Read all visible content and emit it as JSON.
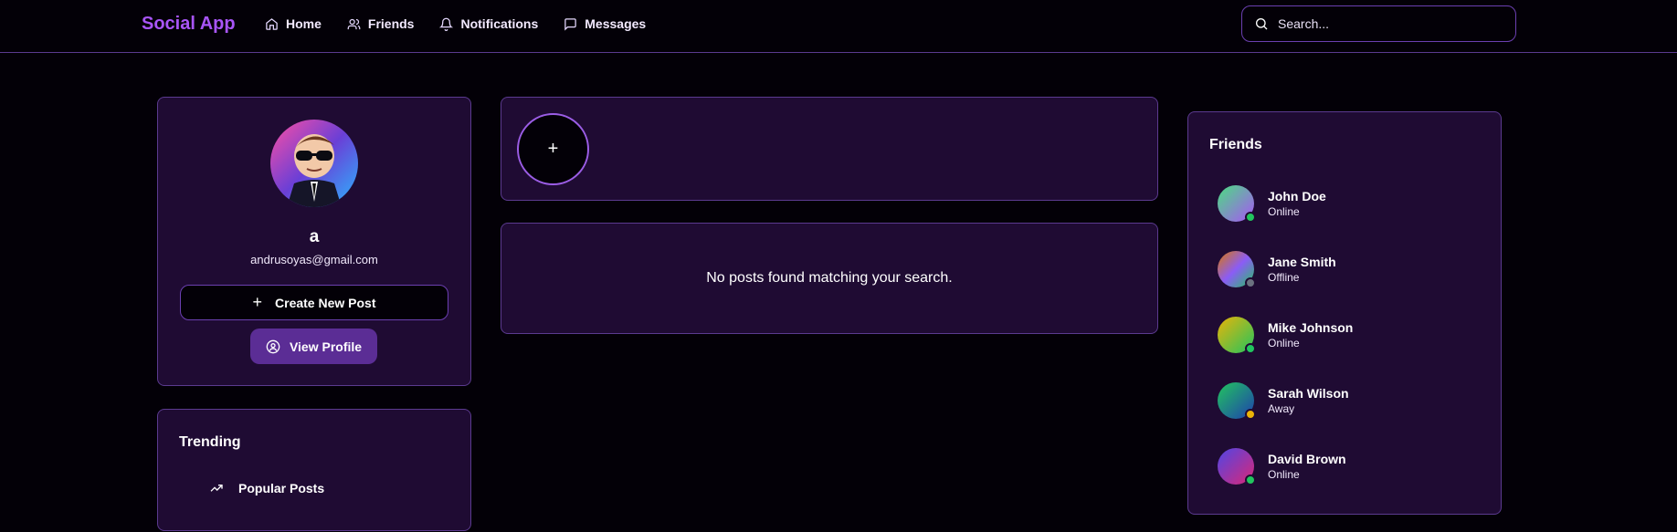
{
  "nav": {
    "brand": "Social App",
    "links": [
      {
        "label": "Home",
        "icon": "home-icon"
      },
      {
        "label": "Friends",
        "icon": "users-icon"
      },
      {
        "label": "Notifications",
        "icon": "bell-icon"
      },
      {
        "label": "Messages",
        "icon": "message-icon"
      }
    ],
    "search_placeholder": "Search..."
  },
  "profile": {
    "name": "a",
    "email": "andrusoyas@gmail.com",
    "create_post_label": "Create New Post",
    "view_profile_label": "View Profile"
  },
  "trending": {
    "title": "Trending",
    "item_label": "Popular Posts"
  },
  "stories": {
    "add_label": "+"
  },
  "posts": {
    "empty_message": "No posts found matching your search."
  },
  "friends": {
    "title": "Friends",
    "items": [
      {
        "name": "John Doe",
        "status": "Online",
        "status_color": "#22c55e"
      },
      {
        "name": "Jane Smith",
        "status": "Offline",
        "status_color": "#6b7280"
      },
      {
        "name": "Mike Johnson",
        "status": "Online",
        "status_color": "#22c55e"
      },
      {
        "name": "Sarah Wilson",
        "status": "Away",
        "status_color": "#eab308"
      },
      {
        "name": "David Brown",
        "status": "Online",
        "status_color": "#22c55e"
      }
    ]
  },
  "colors": {
    "accent": "#a855f7",
    "card_bg": "#1f0b33",
    "border": "#5b3a8f",
    "button_purple": "#5b2d95"
  }
}
